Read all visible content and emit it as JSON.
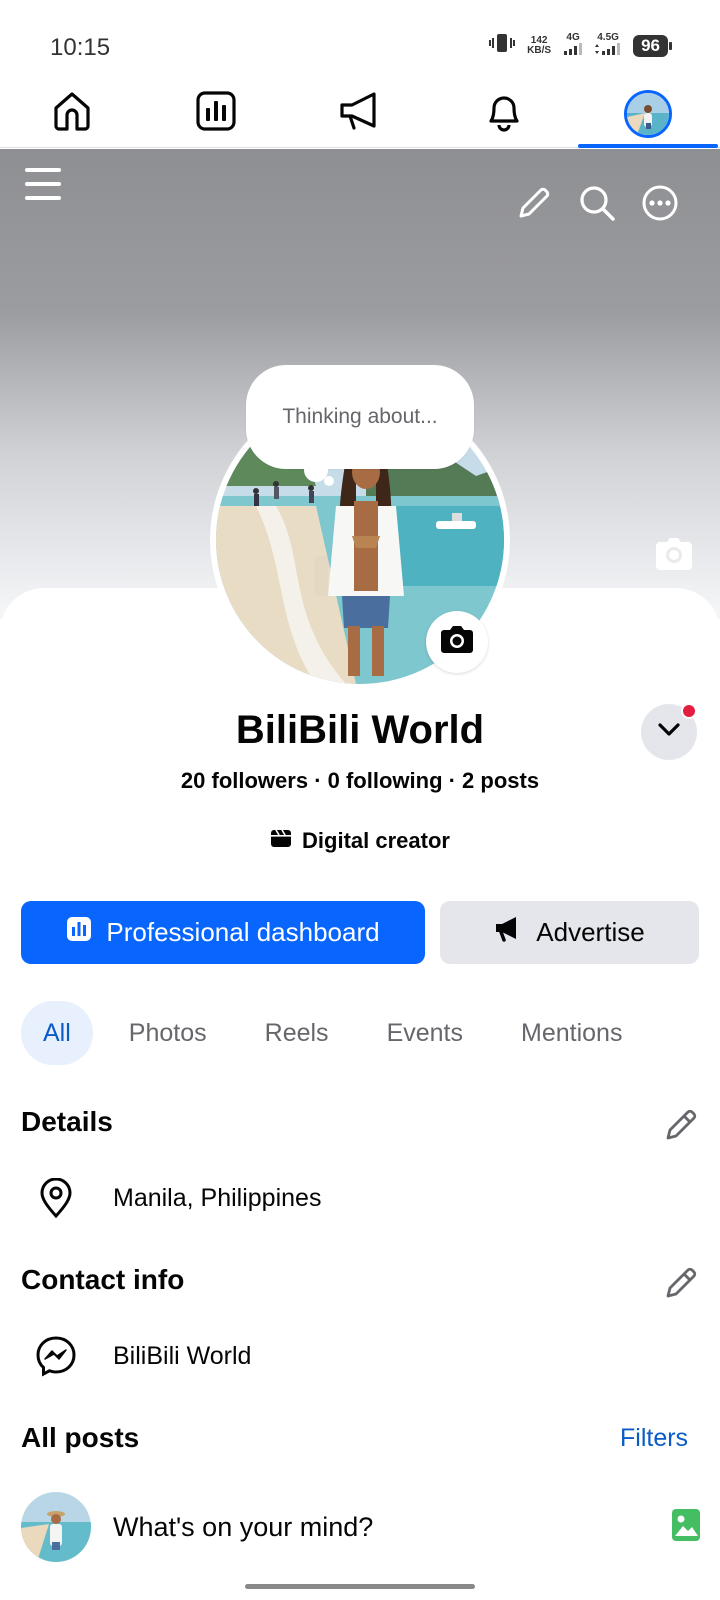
{
  "status_bar": {
    "time": "10:15",
    "net_speed_value": "142",
    "net_speed_unit": "KB/S",
    "signal_1": "4G",
    "signal_2": "4.5G",
    "battery": "96"
  },
  "top_nav": {
    "tabs": [
      {
        "name": "home-icon",
        "active": false
      },
      {
        "name": "dashboard-icon",
        "active": false
      },
      {
        "name": "megaphone-icon",
        "active": false
      },
      {
        "name": "bell-icon",
        "active": false
      },
      {
        "name": "profile-avatar",
        "active": true
      }
    ]
  },
  "cover": {
    "menu_icon": "hamburger-icon",
    "actions": [
      "pencil-icon",
      "search-icon",
      "more-icon"
    ],
    "camera_icon": "camera-icon"
  },
  "profile": {
    "note_bubble": "Thinking about...",
    "name": "BiliBili World",
    "stats": "20 followers · 0 following · 2 posts",
    "category": "Digital creator"
  },
  "buttons": {
    "primary": "Professional dashboard",
    "secondary": "Advertise"
  },
  "filter_tabs": [
    "All",
    "Photos",
    "Reels",
    "Events",
    "Mentions"
  ],
  "details": {
    "title": "Details",
    "location": "Manila, Philippines"
  },
  "contact": {
    "title": "Contact info",
    "messenger": "BiliBili World"
  },
  "posts": {
    "title": "All posts",
    "filters_link": "Filters",
    "composer_placeholder": "What's on your mind?"
  },
  "colors": {
    "brand_blue": "#0866ff",
    "link_blue": "#0a5bc6",
    "secondary_bg": "#e4e6eb",
    "photo_green": "#45bd62",
    "notification_red": "#e41e3f"
  }
}
